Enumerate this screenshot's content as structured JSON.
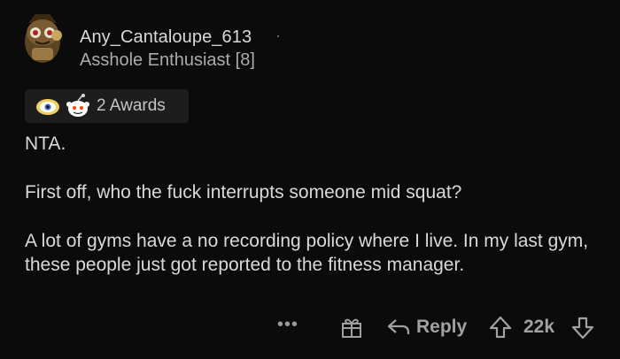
{
  "comment": {
    "username": "Any_Cantaloupe_613",
    "separator": "·",
    "flair": "Asshole Enthusiast [8]",
    "avatar_icon": "snoo-avatar-icon",
    "awards": {
      "icons": [
        "helpful-award-icon",
        "wholesome-award-icon"
      ],
      "label": "2 Awards"
    },
    "paragraphs": [
      "NTA.",
      "First off, who the fuck interrupts someone mid squat?",
      "A lot of gyms have a no recording policy where I live. In my last gym, these people just got reported to the fitness manager."
    ],
    "actions": {
      "more_label": "•••",
      "gift_icon": "gift-icon",
      "reply_label": "Reply",
      "score": "22k"
    }
  },
  "colors": {
    "background": "#0b0b0b",
    "text": "#d7dadc",
    "muted": "#9fa1a3",
    "award_bg": "#1d1d1d"
  }
}
